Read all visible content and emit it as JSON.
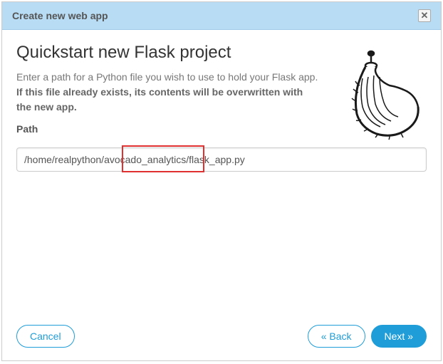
{
  "header": {
    "title": "Create new web app"
  },
  "main": {
    "heading": "Quickstart new Flask project",
    "description_part1": "Enter a path for a Python file you wish to use to hold your Flask app. ",
    "description_bold": "If this file already exists, its contents will be overwritten with the new app.",
    "path_label": "Path",
    "path_value": "/home/realpython/avocado_analytics/flask_app.py",
    "highlight_text": "avocado_analytics"
  },
  "footer": {
    "cancel": "Cancel",
    "back": "« Back",
    "next": "Next »"
  },
  "icons": {
    "close": "✕",
    "flask_logo": "flask-horn-icon"
  }
}
